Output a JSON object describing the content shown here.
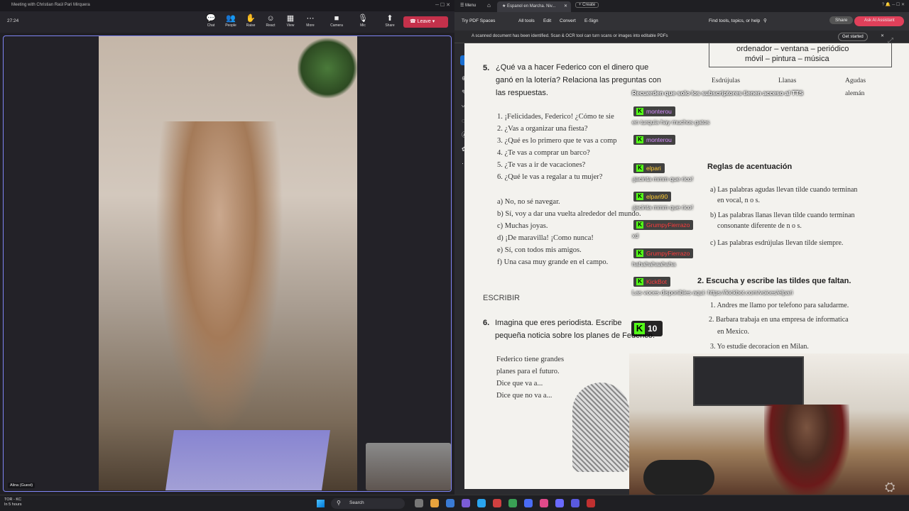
{
  "teams": {
    "window_title": "Meeting with Christian Raúl Pari Mirquera",
    "timer": "27:24",
    "toolbar": [
      {
        "label": "Chat",
        "icon": "chat-icon",
        "glyph": "💬"
      },
      {
        "label": "People",
        "icon": "people-icon",
        "glyph": "👥"
      },
      {
        "label": "Raise",
        "icon": "raise-hand-icon",
        "glyph": "✋"
      },
      {
        "label": "React",
        "icon": "react-icon",
        "glyph": "☺"
      },
      {
        "label": "View",
        "icon": "view-icon",
        "glyph": "▦"
      },
      {
        "label": "More",
        "icon": "more-icon",
        "glyph": "⋯"
      },
      {
        "label": "Camera",
        "icon": "camera-icon",
        "glyph": "■"
      },
      {
        "label": "Mic",
        "icon": "mic-icon",
        "glyph": "🎙"
      },
      {
        "label": "Share",
        "icon": "share-icon",
        "glyph": "⬆"
      }
    ],
    "people_count": "2",
    "leave_label": "Leave",
    "guest_label": "Alina (Guest)"
  },
  "browser": {
    "menu_label": "Menu",
    "tab_title": "Espanol en Marcha. Niv...",
    "new_tab_label": "Create",
    "toolbar": {
      "try_pdf": "Try PDF Spaces",
      "items": [
        "All tools",
        "Edit",
        "Convert",
        "E-Sign"
      ],
      "find_placeholder": "Find tools, topics, or help",
      "share_label": "Share",
      "ask_label": "Ask AI Assistant"
    },
    "banner": {
      "text": "A scanned document has been identified. Scan & OCR tool can turn scans or images into editable PDFs",
      "button": "Get started"
    }
  },
  "pdf": {
    "top_box_line1": "ordenador – ventana – periódico",
    "top_box_line2": "móvil – pintura – música",
    "col_headers": [
      "Esdrújulas",
      "Llanas",
      "Agudas"
    ],
    "agudas_example": "alemán",
    "q5_num": "5.",
    "q5_lines": [
      "¿Qué va a hacer Federico con el dinero que",
      "ganó en la lotería? Relaciona las preguntas con",
      "las respuestas."
    ],
    "questions": [
      "1. ¡Felicidades, Federico! ¿Cómo te sie",
      "2. ¿Vas a organizar una fiesta?",
      "3. ¿Qué es lo primero que te vas a comp",
      "4. ¿Te vas a comprar un barco?",
      "5. ¿Te vas a ir de vacaciones?",
      "6. ¿Qué le vas a regalar a tu mujer?"
    ],
    "answers": [
      "a) No, no sé navegar.",
      "b) Sí, voy a dar una vuelta alrededor del mundo.",
      "c) Muchas joyas.",
      "d) ¡De maravilla! ¡Como nunca!",
      "e) Sí, con todos mis amigos.",
      "f) Una casa muy grande en el campo."
    ],
    "escribir": "ESCRIBIR",
    "q6_num": "6.",
    "q6_lines": [
      "Imagina que eres periodista. Escribe",
      "pequeña noticia sobre los planes de Federico."
    ],
    "q6_prompts": [
      "Federico tiene grandes",
      "planes para el futuro.",
      "Dice que va a...",
      "Dice que no va a..."
    ],
    "reglas_title": "Reglas de acentuación",
    "reglas": [
      "a) Las palabras agudas llevan tilde cuando terminan",
      "en vocal, n o s.",
      "b) Las palabras llanas llevan tilde cuando terminan",
      "consonante diferente de n o s.",
      "c) Las palabras esdrújulas llevan tilde siempre."
    ],
    "ex2_title": "2. Escucha y escribe las tildes que faltan.",
    "ex2_lines": [
      "1. Andres me llamo por telefono para saludarme.",
      "2. Barbara trabaja en una empresa de informatica",
      "en Mexico.",
      "3. Yo estudie decoracion en Milan."
    ]
  },
  "chat": {
    "pinned": "Recuerden que solo los subscriptores tienen acceso al TTS",
    "messages": [
      {
        "user": "monterou",
        "color": "#d68cff",
        "text": "en turquia hay muchos gatos"
      },
      {
        "user": "monterou",
        "color": "#d68cff",
        "text": ""
      },
      {
        "user": "elpari",
        "color": "#ffcc33",
        "text": "¡jacinta mmm que rico!"
      },
      {
        "user": "elpari90",
        "color": "#ffcc33",
        "text": "¡jacinta mmm que rico!"
      },
      {
        "user": "GrumpyFierrazo",
        "color": "#ff3b3b",
        "text": "xd"
      },
      {
        "user": "GrumpyFierrazo",
        "color": "#ff3b3b",
        "text": "hahahahaahaha"
      },
      {
        "user": "KickBot",
        "color": "#ff3b3b",
        "text": "Las voces disponibles aqui: https://kickbot.com/voices/elpari"
      }
    ],
    "kick_count": "10"
  },
  "taskbar": {
    "weather_line1": "TOR - KC",
    "weather_line2": "In 5 hours",
    "search_label": "Search"
  }
}
